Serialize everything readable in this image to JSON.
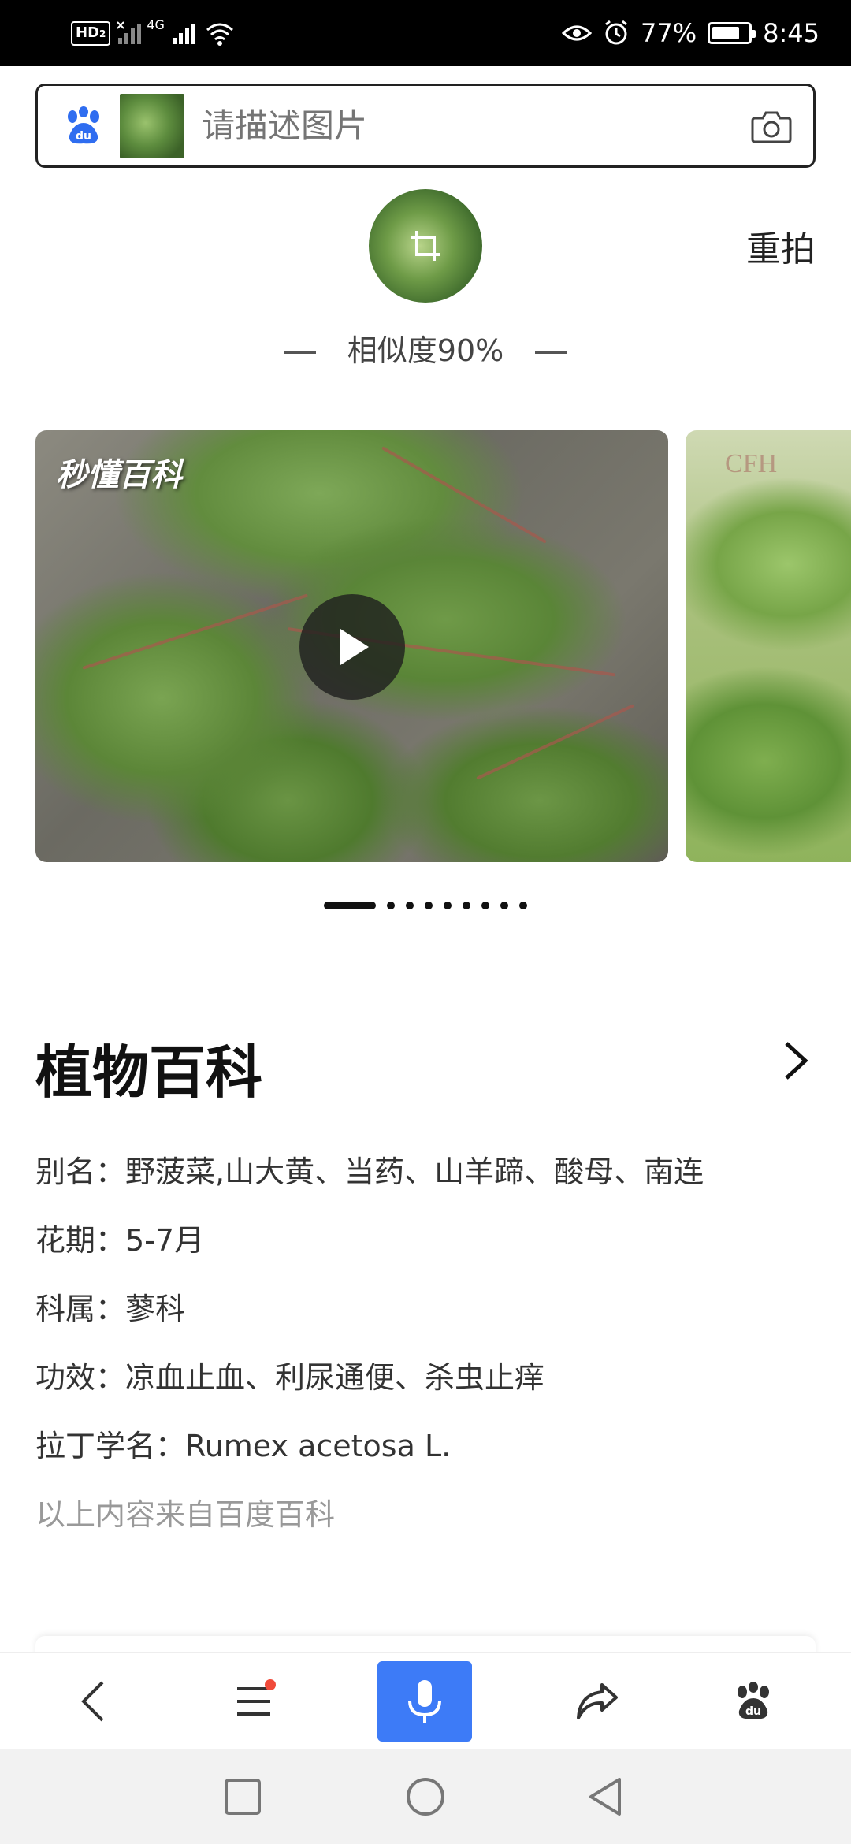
{
  "status_bar": {
    "hd_label": "HD",
    "hd_sub": "2",
    "network_label": "4G",
    "battery_percent": "77%",
    "battery_level": 0.77,
    "time": "8:45"
  },
  "search": {
    "placeholder": "请描述图片",
    "logo_icon": "baidu-paw-icon",
    "camera_icon": "camera-icon"
  },
  "result": {
    "retake_label": "重拍",
    "similarity_label": "相似度90%"
  },
  "carousel": {
    "brand_text": "秒懂百科",
    "next_slide_mark": "CFH",
    "active_index": 0,
    "dot_count": 9
  },
  "encyclopedia": {
    "title": "植物百科",
    "rows": [
      "别名：野菠菜,山大黄、当药、山羊蹄、酸母、南连",
      "花期：5-7月",
      "科属：蓼科",
      "功效：凉血止血、利尿通便、杀虫止痒",
      "拉丁学名：Rumex acetosa L."
    ],
    "source": "以上内容来自百度百科"
  },
  "toolbar": {
    "items": [
      "back-icon",
      "menu-icon",
      "microphone-icon",
      "share-icon",
      "baidu-paw-icon"
    ],
    "accent_color": "#3d7bf7",
    "notification_color": "#f04a3a"
  },
  "nav": {
    "items": [
      "recents-square-icon",
      "home-circle-icon",
      "back-triangle-icon"
    ]
  }
}
